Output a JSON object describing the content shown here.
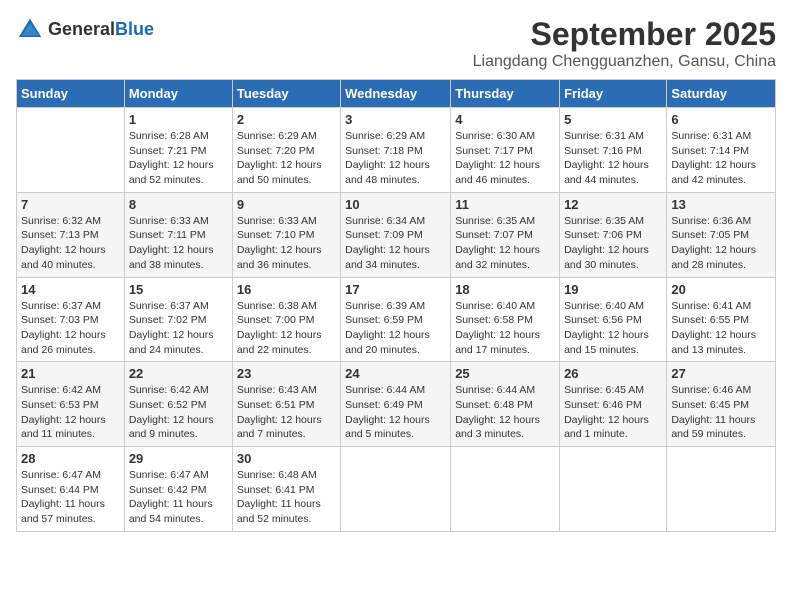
{
  "header": {
    "logo_general": "General",
    "logo_blue": "Blue",
    "month_title": "September 2025",
    "location": "Liangdang Chengguanzhen, Gansu, China"
  },
  "days_of_week": [
    "Sunday",
    "Monday",
    "Tuesday",
    "Wednesday",
    "Thursday",
    "Friday",
    "Saturday"
  ],
  "weeks": [
    [
      {
        "day": "",
        "info": ""
      },
      {
        "day": "1",
        "info": "Sunrise: 6:28 AM\nSunset: 7:21 PM\nDaylight: 12 hours\nand 52 minutes."
      },
      {
        "day": "2",
        "info": "Sunrise: 6:29 AM\nSunset: 7:20 PM\nDaylight: 12 hours\nand 50 minutes."
      },
      {
        "day": "3",
        "info": "Sunrise: 6:29 AM\nSunset: 7:18 PM\nDaylight: 12 hours\nand 48 minutes."
      },
      {
        "day": "4",
        "info": "Sunrise: 6:30 AM\nSunset: 7:17 PM\nDaylight: 12 hours\nand 46 minutes."
      },
      {
        "day": "5",
        "info": "Sunrise: 6:31 AM\nSunset: 7:16 PM\nDaylight: 12 hours\nand 44 minutes."
      },
      {
        "day": "6",
        "info": "Sunrise: 6:31 AM\nSunset: 7:14 PM\nDaylight: 12 hours\nand 42 minutes."
      }
    ],
    [
      {
        "day": "7",
        "info": "Sunrise: 6:32 AM\nSunset: 7:13 PM\nDaylight: 12 hours\nand 40 minutes."
      },
      {
        "day": "8",
        "info": "Sunrise: 6:33 AM\nSunset: 7:11 PM\nDaylight: 12 hours\nand 38 minutes."
      },
      {
        "day": "9",
        "info": "Sunrise: 6:33 AM\nSunset: 7:10 PM\nDaylight: 12 hours\nand 36 minutes."
      },
      {
        "day": "10",
        "info": "Sunrise: 6:34 AM\nSunset: 7:09 PM\nDaylight: 12 hours\nand 34 minutes."
      },
      {
        "day": "11",
        "info": "Sunrise: 6:35 AM\nSunset: 7:07 PM\nDaylight: 12 hours\nand 32 minutes."
      },
      {
        "day": "12",
        "info": "Sunrise: 6:35 AM\nSunset: 7:06 PM\nDaylight: 12 hours\nand 30 minutes."
      },
      {
        "day": "13",
        "info": "Sunrise: 6:36 AM\nSunset: 7:05 PM\nDaylight: 12 hours\nand 28 minutes."
      }
    ],
    [
      {
        "day": "14",
        "info": "Sunrise: 6:37 AM\nSunset: 7:03 PM\nDaylight: 12 hours\nand 26 minutes."
      },
      {
        "day": "15",
        "info": "Sunrise: 6:37 AM\nSunset: 7:02 PM\nDaylight: 12 hours\nand 24 minutes."
      },
      {
        "day": "16",
        "info": "Sunrise: 6:38 AM\nSunset: 7:00 PM\nDaylight: 12 hours\nand 22 minutes."
      },
      {
        "day": "17",
        "info": "Sunrise: 6:39 AM\nSunset: 6:59 PM\nDaylight: 12 hours\nand 20 minutes."
      },
      {
        "day": "18",
        "info": "Sunrise: 6:40 AM\nSunset: 6:58 PM\nDaylight: 12 hours\nand 17 minutes."
      },
      {
        "day": "19",
        "info": "Sunrise: 6:40 AM\nSunset: 6:56 PM\nDaylight: 12 hours\nand 15 minutes."
      },
      {
        "day": "20",
        "info": "Sunrise: 6:41 AM\nSunset: 6:55 PM\nDaylight: 12 hours\nand 13 minutes."
      }
    ],
    [
      {
        "day": "21",
        "info": "Sunrise: 6:42 AM\nSunset: 6:53 PM\nDaylight: 12 hours\nand 11 minutes."
      },
      {
        "day": "22",
        "info": "Sunrise: 6:42 AM\nSunset: 6:52 PM\nDaylight: 12 hours\nand 9 minutes."
      },
      {
        "day": "23",
        "info": "Sunrise: 6:43 AM\nSunset: 6:51 PM\nDaylight: 12 hours\nand 7 minutes."
      },
      {
        "day": "24",
        "info": "Sunrise: 6:44 AM\nSunset: 6:49 PM\nDaylight: 12 hours\nand 5 minutes."
      },
      {
        "day": "25",
        "info": "Sunrise: 6:44 AM\nSunset: 6:48 PM\nDaylight: 12 hours\nand 3 minutes."
      },
      {
        "day": "26",
        "info": "Sunrise: 6:45 AM\nSunset: 6:46 PM\nDaylight: 12 hours\nand 1 minute."
      },
      {
        "day": "27",
        "info": "Sunrise: 6:46 AM\nSunset: 6:45 PM\nDaylight: 11 hours\nand 59 minutes."
      }
    ],
    [
      {
        "day": "28",
        "info": "Sunrise: 6:47 AM\nSunset: 6:44 PM\nDaylight: 11 hours\nand 57 minutes."
      },
      {
        "day": "29",
        "info": "Sunrise: 6:47 AM\nSunset: 6:42 PM\nDaylight: 11 hours\nand 54 minutes."
      },
      {
        "day": "30",
        "info": "Sunrise: 6:48 AM\nSunset: 6:41 PM\nDaylight: 11 hours\nand 52 minutes."
      },
      {
        "day": "",
        "info": ""
      },
      {
        "day": "",
        "info": ""
      },
      {
        "day": "",
        "info": ""
      },
      {
        "day": "",
        "info": ""
      }
    ]
  ]
}
